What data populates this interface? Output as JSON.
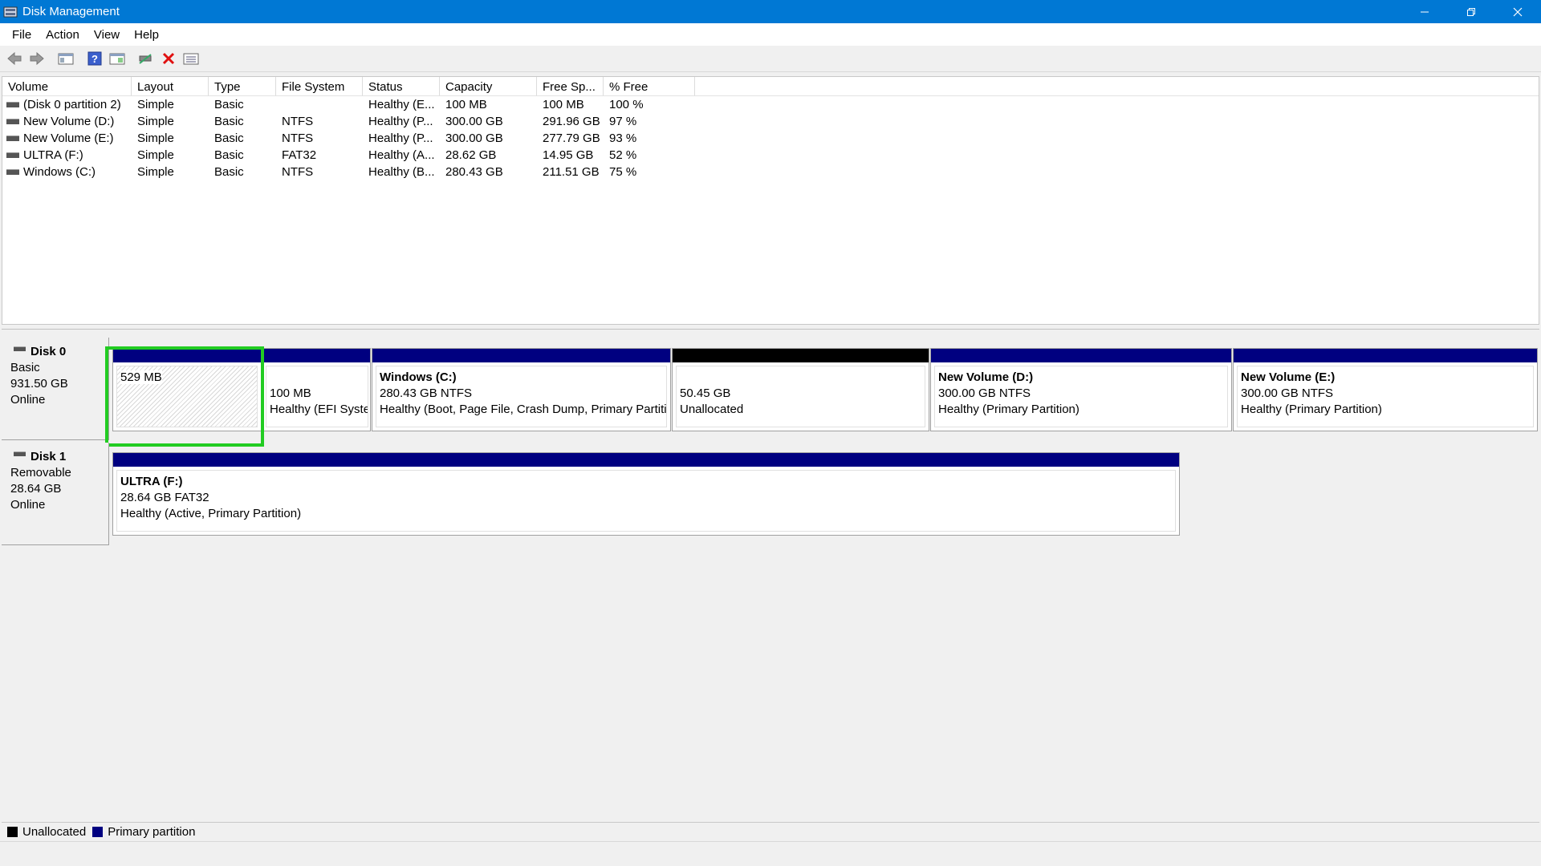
{
  "window": {
    "title": "Disk Management"
  },
  "menu": [
    "File",
    "Action",
    "View",
    "Help"
  ],
  "toolbar": [
    "back-arrow-icon",
    "forward-arrow-icon",
    "console-tree-icon",
    "help-icon",
    "properties-icon",
    "connect-icon",
    "delete-icon",
    "settings-list-icon"
  ],
  "volume_table": {
    "columns": [
      "Volume",
      "Layout",
      "Type",
      "File System",
      "Status",
      "Capacity",
      "Free Sp...",
      "% Free"
    ],
    "rows": [
      [
        "(Disk 0 partition 2)",
        "Simple",
        "Basic",
        "",
        "Healthy (E...",
        "100 MB",
        "100 MB",
        "100 %"
      ],
      [
        "New Volume (D:)",
        "Simple",
        "Basic",
        "NTFS",
        "Healthy (P...",
        "300.00 GB",
        "291.96 GB",
        "97 %"
      ],
      [
        "New Volume (E:)",
        "Simple",
        "Basic",
        "NTFS",
        "Healthy (P...",
        "300.00 GB",
        "277.79 GB",
        "93 %"
      ],
      [
        "ULTRA (F:)",
        "Simple",
        "Basic",
        "FAT32",
        "Healthy (A...",
        "28.62 GB",
        "14.95 GB",
        "52 %"
      ],
      [
        "Windows (C:)",
        "Simple",
        "Basic",
        "NTFS",
        "Healthy (B...",
        "280.43 GB",
        "211.51 GB",
        "75 %"
      ]
    ]
  },
  "disks": [
    {
      "name": "Disk 0",
      "type": "Basic",
      "size": "931.50 GB",
      "status": "Online",
      "partitions": [
        {
          "title": "",
          "line1": "529 MB",
          "line2": ""
        },
        {
          "title": "",
          "line1": "100 MB",
          "line2": "Healthy (EFI Syste"
        },
        {
          "title": "Windows  (C:)",
          "line1": "280.43 GB NTFS",
          "line2": "Healthy (Boot, Page File, Crash Dump, Primary Partitic"
        },
        {
          "title": "",
          "line1": "50.45 GB",
          "line2": "Unallocated"
        },
        {
          "title": "New Volume  (D:)",
          "line1": "300.00 GB NTFS",
          "line2": "Healthy (Primary Partition)"
        },
        {
          "title": "New Volume  (E:)",
          "line1": "300.00 GB NTFS",
          "line2": "Healthy (Primary Partition)"
        }
      ]
    },
    {
      "name": "Disk 1",
      "type": "Removable",
      "size": "28.64 GB",
      "status": "Online",
      "partitions": [
        {
          "title": "ULTRA  (F:)",
          "line1": "28.64 GB FAT32",
          "line2": "Healthy (Active, Primary Partition)"
        }
      ]
    }
  ],
  "legend": [
    "Unallocated",
    "Primary partition"
  ],
  "colors": {
    "titlebar": "#0078d4",
    "primary": "#000080",
    "unallocated": "#000000",
    "highlight": "#22cc22"
  }
}
